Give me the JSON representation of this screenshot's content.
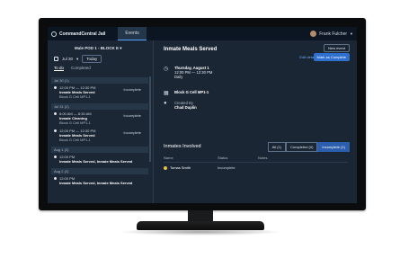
{
  "app": {
    "brand": "CommandCentral Jail",
    "tab": "Events",
    "user": "Frank Fulcher"
  },
  "left": {
    "block": "Male POD 1 - BLOCK E",
    "date": "Jul 30",
    "today": "Today",
    "tabs": [
      "To do",
      "Completed"
    ],
    "days": [
      {
        "header": "Jul 30 (1)",
        "items": [
          {
            "time": "12:00 PM — 12:30 PM",
            "title": "Inmate Meals Served",
            "sub": "Block G Cell MP1-1",
            "status": "Incomplete"
          }
        ]
      },
      {
        "header": "Jul 31 (2)",
        "items": [
          {
            "time": "8:00 AM — 8:30 AM",
            "title": "Inmate Cleaning",
            "sub": "Block G Cell MP1-1",
            "status": "Incomplete"
          },
          {
            "time": "12:00 PM — 12:30 PM",
            "title": "Inmate Meals Served",
            "sub": "Block G Cell MP1-1",
            "status": "Incomplete"
          }
        ]
      },
      {
        "header": "Aug 1 (2)",
        "items": [
          {
            "time": "12:00 PM",
            "title": "Inmate Meals Served, Inmate Meals Served",
            "sub": "",
            "status": ""
          }
        ]
      },
      {
        "header": "Aug 2 (2)",
        "items": [
          {
            "time": "12:00 PM",
            "title": "Inmate Meals Served, Inmate Meals Served",
            "sub": "",
            "status": ""
          }
        ]
      }
    ]
  },
  "detail": {
    "title": "Inmate Meals Served",
    "new_event": "New event",
    "edit": "Edit details",
    "mark": "Mark as Complete",
    "date": "Thursday, August 1",
    "time": "12:00 PM — 12:30 PM",
    "repeat": "Daily",
    "location": "Block G Cell MP1-1",
    "created_label": "Created By",
    "created_by": "Chad Duplin"
  },
  "inmates": {
    "title": "Inmates Involved",
    "filters": [
      "All (1)",
      "Completed (0)",
      "Incomplete (1)"
    ],
    "columns": [
      "Name",
      "Status",
      "Notes"
    ],
    "rows": [
      {
        "name": "Tomas Smith",
        "status": "Incomplete",
        "notes": ""
      }
    ]
  }
}
